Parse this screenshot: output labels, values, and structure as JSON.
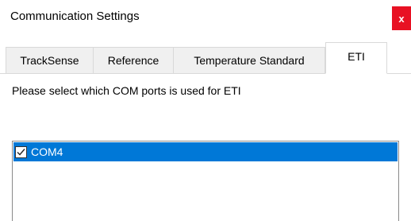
{
  "window": {
    "title": "Communication Settings",
    "close_label": "x"
  },
  "tabs": [
    {
      "label": "TrackSense",
      "selected": false
    },
    {
      "label": "Reference",
      "selected": false
    },
    {
      "label": "Temperature Standard",
      "selected": false
    },
    {
      "label": "ETI",
      "selected": true
    }
  ],
  "eti_panel": {
    "instruction": "Please select which COM ports is used for ETI",
    "com_ports": [
      {
        "label": "COM4",
        "checked": true,
        "selected": true
      }
    ]
  },
  "colors": {
    "selection": "#0078d7",
    "close_button": "#e81123"
  }
}
